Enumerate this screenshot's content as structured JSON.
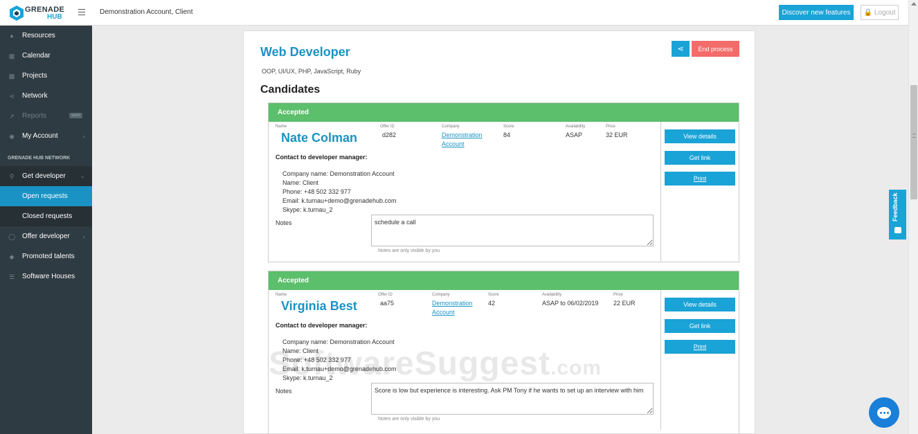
{
  "header": {
    "logo_line1": "GRENADE",
    "logo_line2": "HUB",
    "account": "Demonstration Account, Client",
    "features_button": "Discover new features",
    "logout_button": "Logout"
  },
  "sidebar": {
    "items": [
      {
        "label": "Resources",
        "icon": "users-icon"
      },
      {
        "label": "Calendar",
        "icon": "calendar-icon"
      },
      {
        "label": "Projects",
        "icon": "briefcase-icon"
      },
      {
        "label": "Network",
        "icon": "share-icon"
      },
      {
        "label": "Reports",
        "icon": "chart-icon",
        "tag": "soon"
      },
      {
        "label": "My Account",
        "icon": "user-icon"
      }
    ],
    "section_title": "GRENADE HUB NETWORK",
    "network_items": [
      {
        "label": "Get developer",
        "icon": "search-icon"
      },
      {
        "label": "Open requests"
      },
      {
        "label": "Closed requests"
      },
      {
        "label": "Offer developer",
        "icon": "globe-icon"
      },
      {
        "label": "Promoted talents",
        "icon": "diamond-icon"
      },
      {
        "label": "Software Houses",
        "icon": "list-icon"
      }
    ]
  },
  "job": {
    "title": "Web Developer",
    "skills": "OOP, UI/UX, PHP, JavaScript, Ruby",
    "end_button": "End process",
    "candidates_heading": "Candidates"
  },
  "labels": {
    "name": "Name",
    "offer_id": "Offer ID",
    "company": "Company",
    "score": "Score",
    "availability": "Availability",
    "price": "Price",
    "contact_heading": "Contact to developer manager:",
    "notes": "Notes",
    "notes_hint": "Notes are only visible by you",
    "view_details": "View details",
    "get_link": "Get link",
    "print": "Print"
  },
  "candidates": [
    {
      "status": "Accepted",
      "name": "Nate Colman",
      "offer_id": "d282",
      "company_line1": "Demonstration",
      "company_line2": "Account",
      "score": "84",
      "availability": "ASAP",
      "price": "32 EUR",
      "contact": [
        "Company name: Demonstration Account",
        "Name: Client",
        "Phone: +48 502 332 977",
        "Email: k.turnau+demo@grenadehub.com",
        "Skype: k.turnau_2"
      ],
      "notes": "schedule a call"
    },
    {
      "status": "Accepted",
      "name": "Virginia Best",
      "offer_id": "aa75",
      "company_line1": "Demonstration",
      "company_line2": "Account",
      "score": "42",
      "availability": "ASAP to 06/02/2019",
      "price": "22 EUR",
      "contact": [
        "Company name: Demonstration Account",
        "Name: Client",
        "Phone: +48 502 332 977",
        "Email: k.turnau+demo@grenadehub.com",
        "Skype: k.turnau_2"
      ],
      "notes": "Score is low but experience is interesting. Ask PM Tony if he wants to set up an interview with him"
    }
  ],
  "feedback_tab": "Feedback",
  "watermark": {
    "main": "SoftwareSuggest",
    "suffix": ".com"
  },
  "colors": {
    "accent": "#1aa3d6",
    "sidebar": "#2f3b42",
    "accepted": "#5cbf6c",
    "danger": "#f26c6a"
  }
}
